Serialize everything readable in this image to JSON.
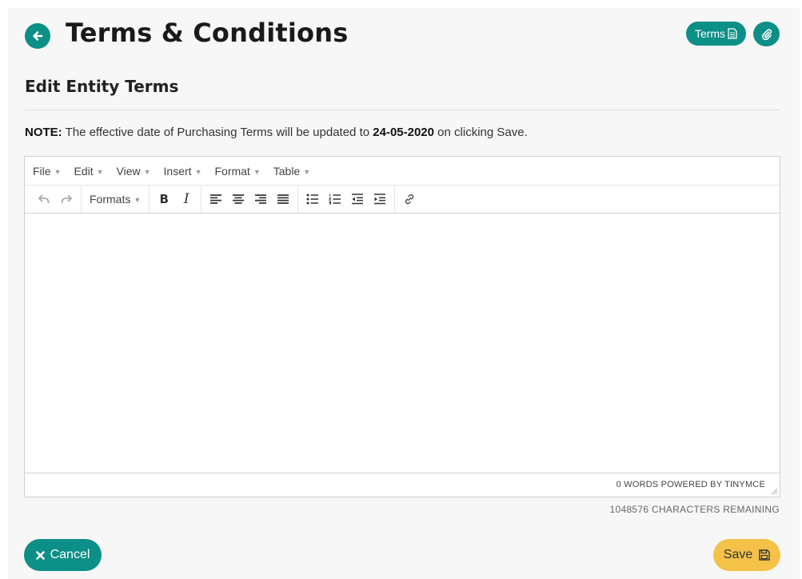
{
  "header": {
    "title": "Terms & Conditions",
    "back_icon": "arrow-left-icon",
    "terms_button_label": "Terms",
    "terms_button_icon": "document-icon",
    "attach_icon": "paperclip-icon"
  },
  "section": {
    "title": "Edit Entity Terms"
  },
  "note": {
    "label": "NOTE:",
    "text_before": "The effective date of Purchasing Terms will be updated to",
    "date": "24-05-2020",
    "text_after": "on clicking Save."
  },
  "editor": {
    "menu": [
      "File",
      "Edit",
      "View",
      "Insert",
      "Format",
      "Table"
    ],
    "formats_label": "Formats",
    "toolbar_icons": [
      "undo-icon",
      "redo-icon",
      "bold-icon",
      "italic-icon",
      "align-left-icon",
      "align-center-icon",
      "align-right-icon",
      "align-justify-icon",
      "bullet-list-icon",
      "numbered-list-icon",
      "outdent-icon",
      "indent-icon",
      "link-icon"
    ],
    "status": "0 WORDS POWERED BY TINYMCE",
    "chars_remaining": "1048576 CHARACTERS REMAINING"
  },
  "footer": {
    "cancel_label": "Cancel",
    "cancel_icon": "close-icon",
    "save_label": "Save",
    "save_icon": "floppy-disk-icon"
  },
  "colors": {
    "primary": "#0c8f86",
    "save": "#f4c249",
    "panel_bg": "#f7f7f7"
  }
}
